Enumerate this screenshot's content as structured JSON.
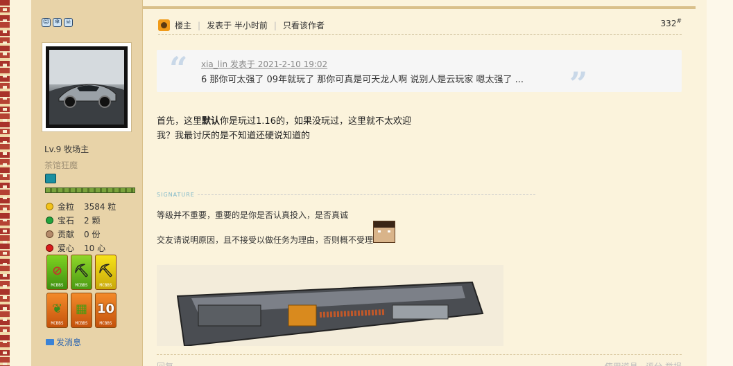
{
  "sidebar": {
    "user_level": "Lv.9 牧场主",
    "user_title": "茶馆狂魔",
    "stats": [
      {
        "icon": "gold-nugget-icon",
        "label": "金粒",
        "value": "3584 粒",
        "color": "#f2c21a"
      },
      {
        "icon": "gem-icon",
        "label": "宝石",
        "value": "2 颗",
        "color": "#22a33c"
      },
      {
        "icon": "contribution-icon",
        "label": "贡献",
        "value": "0 份",
        "color": "#b48a6a"
      },
      {
        "icon": "heart-apple-icon",
        "label": "爱心",
        "value": "10 心",
        "color": "#d81b1b"
      }
    ],
    "medal_label": "MCBBS",
    "send_message": "发消息"
  },
  "post": {
    "author_badge": "楼主",
    "posted_time": "发表于 半小时前",
    "only_author": "只看该作者",
    "floor": "332",
    "floor_suffix": "#",
    "quote": {
      "meta": "xia_lin 发表于 2021-2-10 19:02",
      "text": "6 那你可太强了 09年就玩了 那你可真是可天龙人啊 说别人是云玩家 嗯太强了 ..."
    },
    "body_line1_pre": "首先，这里",
    "body_line1_bold": "默认",
    "body_line1_post": "你是玩过1.16的，如果没玩过，这里就不太欢迎",
    "body_line2": "我？我最讨厌的是不知道还硬说知道的",
    "signature_title": "SIGNATURE",
    "signature_line1": "等级并不重要，重要的是你是否认真投入，是否真诚",
    "signature_line2": "交友请说明原因，且不接受以做任务为理由，否则概不受理",
    "reply_label": "回复",
    "bottom_right": "使用道具 ·  评分  举报"
  }
}
